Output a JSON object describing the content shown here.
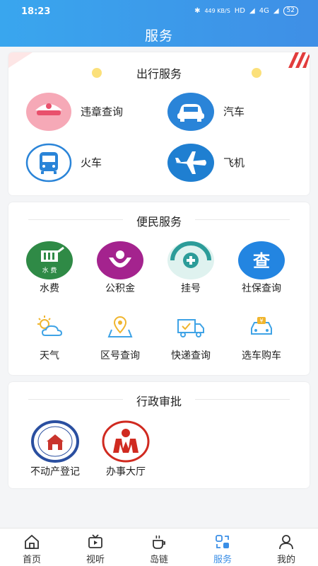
{
  "status_bar": {
    "time": "18:23",
    "network_speed": "449 KB/S",
    "hd_label": "HD",
    "signal_label": "4G",
    "battery": "52"
  },
  "header": {
    "title": "服务"
  },
  "travel": {
    "title": "出行服务",
    "items": [
      {
        "label": "违章查询",
        "icon": "police-cap-icon",
        "color": "#f3a3b3"
      },
      {
        "label": "汽车",
        "icon": "car-icon",
        "color": "#2a84d8"
      },
      {
        "label": "火车",
        "icon": "train-icon",
        "color": "#ffffff"
      },
      {
        "label": "飞机",
        "icon": "airplane-icon",
        "color": "#1f7fd1"
      }
    ]
  },
  "convenience": {
    "title": "便民服务",
    "items": [
      {
        "label": "水费",
        "icon": "water-bill-icon",
        "color": "#2f8a46",
        "badge": "水 费"
      },
      {
        "label": "公积金",
        "icon": "housing-fund-icon",
        "color": "#a4238e"
      },
      {
        "label": "挂号",
        "icon": "registration-icon",
        "color": "#2c9c99"
      },
      {
        "label": "社保查询",
        "icon": "social-security-icon",
        "color": "#2385e1",
        "badge": "查"
      },
      {
        "label": "天气",
        "icon": "weather-icon",
        "color": "#3fa3e6"
      },
      {
        "label": "区号查询",
        "icon": "area-code-icon",
        "color": "#3fa3e6"
      },
      {
        "label": "快递查询",
        "icon": "delivery-truck-icon",
        "color": "#3fa3e6"
      },
      {
        "label": "选车购车",
        "icon": "car-purchase-icon",
        "color": "#3fa3e6"
      }
    ]
  },
  "admin": {
    "title": "行政审批",
    "items": [
      {
        "label": "不动产登记",
        "icon": "real-estate-seal-icon",
        "color": "#2a4fa0"
      },
      {
        "label": "办事大厅",
        "icon": "service-hall-emblem-icon",
        "color": "#d02a20"
      }
    ]
  },
  "tabbar": {
    "items": [
      {
        "label": "首页",
        "icon": "home-icon"
      },
      {
        "label": "视听",
        "icon": "tv-icon"
      },
      {
        "label": "岛链",
        "icon": "coffee-cup-icon"
      },
      {
        "label": "服务",
        "icon": "services-icon",
        "active": true
      },
      {
        "label": "我的",
        "icon": "profile-icon"
      }
    ]
  }
}
